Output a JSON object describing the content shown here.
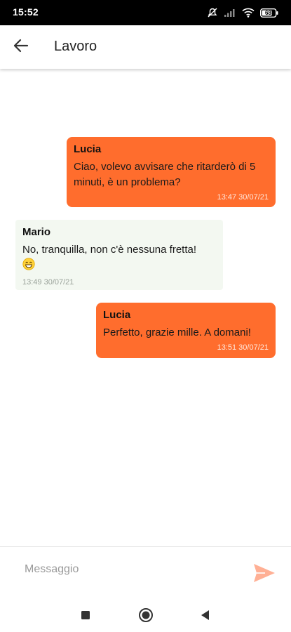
{
  "status_bar": {
    "time": "15:52",
    "battery_level": "68"
  },
  "app_bar": {
    "title": "Lavoro",
    "back_icon": "arrow-left-icon"
  },
  "messages": [
    {
      "direction": "sent",
      "sender": "Lucia",
      "text": "Ciao, volevo avvisare che ritarderò di 5 minuti, è un problema?",
      "timestamp": "13:47 30/07/21"
    },
    {
      "direction": "received",
      "sender": "Mario",
      "text": "No, tranquilla, non c'è nessuna fretta!",
      "emoji": "grinning-face-icon",
      "timestamp": "13:49 30/07/21"
    },
    {
      "direction": "sent",
      "sender": "Lucia",
      "text": "Perfetto, grazie mille. A domani!",
      "timestamp": "13:51 30/07/21"
    }
  ],
  "composer": {
    "placeholder": "Messaggio",
    "value": "",
    "send_icon": "send-icon"
  },
  "nav_bar": {
    "icons": [
      "recents-square-icon",
      "home-circle-icon",
      "back-triangle-icon"
    ]
  },
  "colors": {
    "sent_bubble": "#ff6d2d",
    "received_bubble": "#f3f8f1",
    "send_icon": "#ffb095",
    "status_bar": "#000000"
  }
}
